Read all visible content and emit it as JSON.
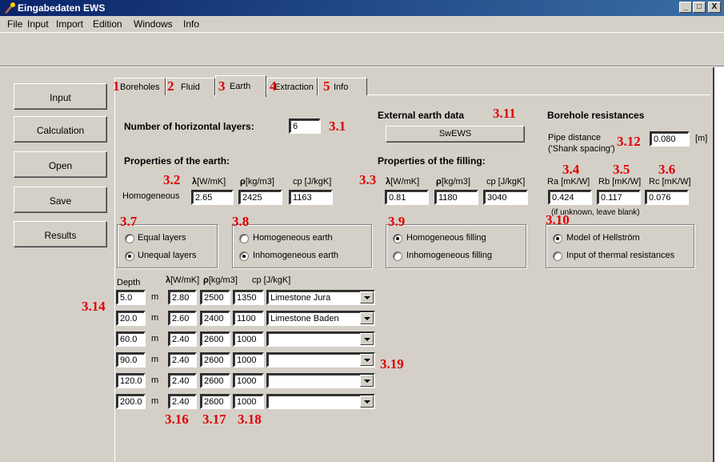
{
  "window": {
    "title": "Eingabedaten EWS",
    "controls": [
      "_",
      "□",
      "X"
    ]
  },
  "menu": [
    "File",
    "Input",
    "Import",
    "Edition",
    "Windows",
    "Info"
  ],
  "sidebar": [
    "Input",
    "Calculation",
    "Open",
    "Save",
    "Results"
  ],
  "tabs": [
    {
      "num": "1",
      "label": "Boreholes"
    },
    {
      "num": "2",
      "label": "Fluid"
    },
    {
      "num": "3",
      "label": "Earth"
    },
    {
      "num": "4",
      "label": "Extraction"
    },
    {
      "num": "5",
      "label": "Info"
    }
  ],
  "active_tab": "Earth",
  "layers": {
    "label": "Number of horizontal layers:",
    "value": "6",
    "num": "3.1"
  },
  "earth": {
    "title": "Properties of the earth:",
    "num_lambda": "3.2",
    "lambda": "[W/mK]",
    "rho": "[kg/m3]",
    "cp": "cp [J/kgK]",
    "row_label": "Homogeneous",
    "v_lambda": "2.65",
    "v_rho": "2425",
    "v_cp": "1163"
  },
  "filling": {
    "title": "Properties of the filling:",
    "num": "3.3",
    "lambda": "[W/mK]",
    "rho": "[kg/m3]",
    "cp": "cp [J/kgK]",
    "v_lambda": "0.81",
    "v_rho": "1180",
    "v_cp": "3040"
  },
  "external": {
    "title": "External earth data",
    "num": "3.11",
    "button": "SwEWS"
  },
  "resistances": {
    "title": "Borehole resistances",
    "pipe_label": "Pipe distance",
    "pipe_sub": "('Shank spacing')",
    "pipe_num": "3.12",
    "pipe_value": "0.080",
    "pipe_unit": "[m]",
    "nums": [
      "3.4",
      "3.5",
      "3.6"
    ],
    "labels": [
      "Ra [mK/W]",
      "Rb [mK/W]",
      "Rc [mK/W]"
    ],
    "values": [
      "0.424",
      "0.117",
      "0.076"
    ],
    "note": "(if unknown, leave blank)"
  },
  "groups": {
    "g37": {
      "num": "3.7",
      "opts": [
        "Equal layers",
        "Unequal layers"
      ],
      "selected": 1
    },
    "g38": {
      "num": "3.8",
      "opts": [
        "Homogeneous earth",
        "Inhomogeneous earth"
      ],
      "selected": 1
    },
    "g39": {
      "num": "3.9",
      "opts": [
        "Homogeneous filling",
        "Inhomogeneous filling"
      ],
      "selected": 0
    },
    "g310": {
      "num": "3.10",
      "opts": [
        "Model of Hellström",
        "Input of thermal resistances"
      ],
      "selected": 0
    }
  },
  "table": {
    "header": {
      "depth": "Depth",
      "lambda": "[W/mK]",
      "rho": "[kg/m3]",
      "cp": "cp [J/kgK]"
    },
    "unit": "m",
    "rows": [
      {
        "depth": "5.0",
        "lambda": "2.80",
        "rho": "2500",
        "cp": "1350",
        "name": "Limestone Jura"
      },
      {
        "depth": "20.0",
        "lambda": "2.60",
        "rho": "2400",
        "cp": "1100",
        "name": "Limestone Baden"
      },
      {
        "depth": "60.0",
        "lambda": "2.40",
        "rho": "2600",
        "cp": "1000",
        "name": ""
      },
      {
        "depth": "90.0",
        "lambda": "2.40",
        "rho": "2600",
        "cp": "1000",
        "name": ""
      },
      {
        "depth": "120.0",
        "lambda": "2.40",
        "rho": "2600",
        "cp": "1000",
        "name": ""
      },
      {
        "depth": "200.0",
        "lambda": "2.40",
        "rho": "2600",
        "cp": "1000",
        "name": ""
      }
    ],
    "nums": {
      "n314": "3.14",
      "n316": "3.16",
      "n317": "3.17",
      "n318": "3.18",
      "n319": "3.19"
    }
  },
  "symbols": {
    "lambda": "λ",
    "rho": "ρ"
  }
}
